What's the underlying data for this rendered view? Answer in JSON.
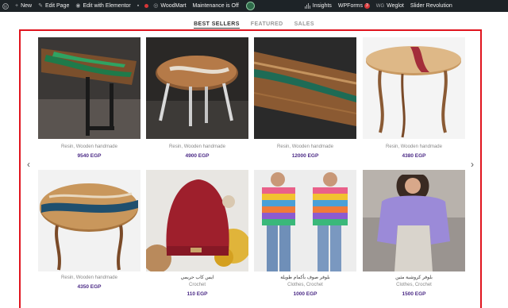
{
  "adminbar": {
    "new": "New",
    "edit_page": "Edit Page",
    "edit_elementor": "Edit with Elementor",
    "woodmart": "WoodMart",
    "maintenance": "Maintenance is Off",
    "insights": "Insights",
    "wpforms": "WPForms",
    "wpforms_badge": "3",
    "weglot": "Weglot",
    "weglot_prefix": "WG",
    "slider": "Slider Revolution"
  },
  "tabs": [
    "BEST SELLERS",
    "FEATURED",
    "SALES"
  ],
  "arrows": {
    "left": "‹",
    "right": "›"
  },
  "products": [
    {
      "categories": "Resin, Wooden handmade",
      "price": "9540 EGP"
    },
    {
      "categories": "Resin, Wooden handmade",
      "price": "4900 EGP"
    },
    {
      "categories": "Resin, Wooden handmade",
      "price": "12000 EGP"
    },
    {
      "categories": "Resin, Wooden handmade",
      "price": "4380 EGP"
    },
    {
      "title": "",
      "categories": "Resin, Wooden handmade",
      "price": "4350 EGP"
    },
    {
      "title": "ايس كاب حريمي",
      "categories": "Crochet",
      "price": "110 EGP"
    },
    {
      "title": "بلوفر صوف بأكمام طويلة",
      "categories": "Clothes, Crochet",
      "price": "1000 EGP"
    },
    {
      "title": "بلوفر كروشية مثين",
      "categories": "Clothes, Crochet",
      "price": "1500 EGP"
    }
  ],
  "colors": {
    "frame": "#e0141e",
    "price": "#4b2a86",
    "adminbar": "#1d2327"
  }
}
